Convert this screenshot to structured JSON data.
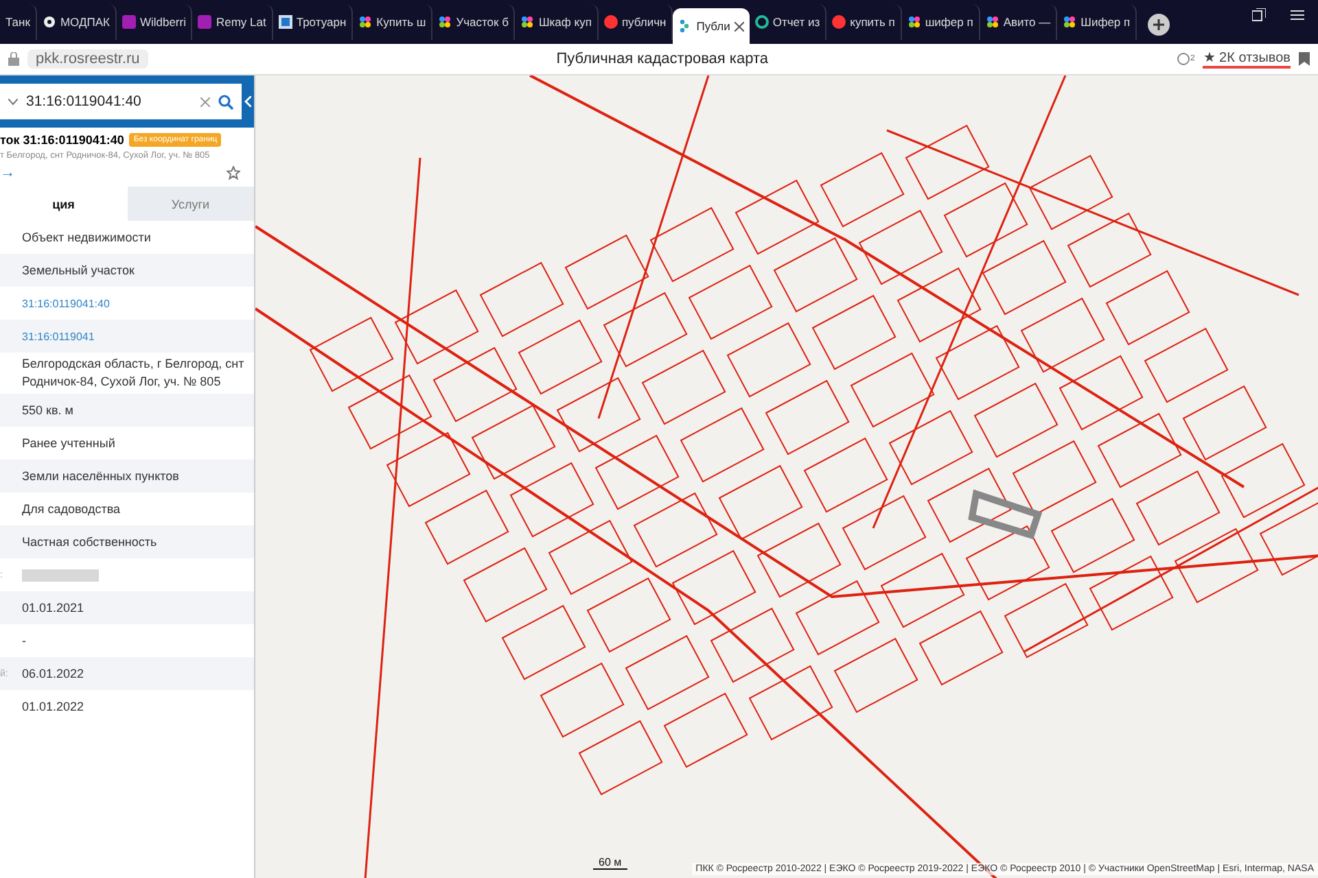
{
  "browser_tabs": [
    {
      "title": "Танк",
      "kind": "none",
      "selected": false
    },
    {
      "title": "МОДПАК",
      "kind": "gear",
      "selected": false
    },
    {
      "title": "Wildberri",
      "kind": "w",
      "selected": false
    },
    {
      "title": "Remy Lat",
      "kind": "w",
      "selected": false
    },
    {
      "title": "Тротуарн",
      "kind": "tile",
      "selected": false
    },
    {
      "title": "Купить ш",
      "kind": "dots",
      "selected": false
    },
    {
      "title": "Участок б",
      "kind": "dots",
      "selected": false
    },
    {
      "title": "Шкаф куп",
      "kind": "dots",
      "selected": false
    },
    {
      "title": "публичн",
      "kind": "ya",
      "selected": false
    },
    {
      "title": "Публи",
      "kind": "pkk",
      "selected": true
    },
    {
      "title": "Отчет из",
      "kind": "circle",
      "selected": false
    },
    {
      "title": "купить п",
      "kind": "ya",
      "selected": false
    },
    {
      "title": "шифер п",
      "kind": "dots",
      "selected": false
    },
    {
      "title": "Авито —",
      "kind": "dots",
      "selected": false
    },
    {
      "title": "Шифер п",
      "kind": "dots",
      "selected": false
    }
  ],
  "address_bar": {
    "url": "pkk.rosreestr.ru",
    "page_title": "Публичная кадастровая карта",
    "protect_count": "2",
    "reviews": "★ 2К отзывов"
  },
  "search": {
    "value": "31:16:0119041:40"
  },
  "object": {
    "title": "ток 31:16:0119041:40",
    "badge": "Без координат границ",
    "address": "т Белгород, снт Родничок-84, Сухой Лог, уч. № 805",
    "arrow": "→"
  },
  "panel_tabs": [
    {
      "label": "ция",
      "selected": true
    },
    {
      "label": "Услуги",
      "selected": false
    }
  ],
  "rows": [
    {
      "kind": "text",
      "value": "Объект недвижимости"
    },
    {
      "kind": "text",
      "value": "Земельный участок"
    },
    {
      "kind": "link",
      "value": "31:16:0119041:40"
    },
    {
      "kind": "link",
      "value": "31:16:0119041"
    },
    {
      "kind": "text",
      "value": "Белгородская область, г Белгород, снт Родничок-84, Сухой Лог, уч. № 805"
    },
    {
      "kind": "text",
      "value": "550 кв. м"
    },
    {
      "kind": "text",
      "value": "Ранее учтенный"
    },
    {
      "kind": "text",
      "value": "Земли населённых пунктов"
    },
    {
      "kind": "text",
      "value": "Для садоводства"
    },
    {
      "kind": "text",
      "value": "Частная собственность"
    },
    {
      "kind": "redacted",
      "label": ":"
    },
    {
      "kind": "text",
      "value": "01.01.2021"
    },
    {
      "kind": "text",
      "value": "-"
    },
    {
      "kind": "text",
      "label": "й:",
      "value": "06.01.2022"
    },
    {
      "kind": "text",
      "value": "01.01.2022"
    }
  ],
  "map": {
    "scale": "60 м",
    "attribution": "ПКК © Росреестр 2010-2022 | ЕЭКО © Росреестр 2019-2022 | ЕЭКО © Росреестр 2010 | © Участники OpenStreetMap | Esri, Intermap, NASA"
  }
}
